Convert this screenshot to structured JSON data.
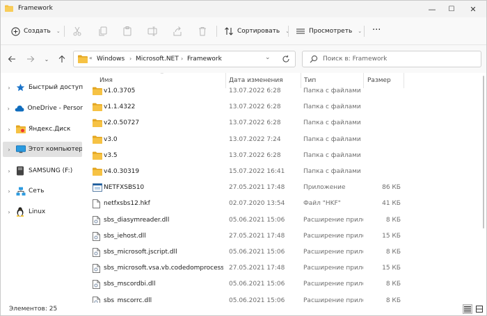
{
  "window": {
    "title": "Framework",
    "minimize": "—",
    "maximize": "☐",
    "close": "✕"
  },
  "toolbar": {
    "new_label": "Создать",
    "sort_label": "Сортировать",
    "view_label": "Просмотреть",
    "more": "···"
  },
  "address": {
    "overflow": "«",
    "crumbs": [
      "Windows",
      "Microsoft.NET",
      "Framework"
    ],
    "search_placeholder": "Поиск в: Framework"
  },
  "sidebar": {
    "items": [
      {
        "label": "Быстрый доступ",
        "icon": "star-icon"
      },
      {
        "label": "OneDrive - Personal",
        "icon": "cloud-icon"
      },
      {
        "label": "Яндекс.Диск",
        "icon": "folder-icon"
      },
      {
        "label": "Этот компьютер",
        "icon": "monitor-icon",
        "selected": true
      },
      {
        "label": "SAMSUNG (F:)",
        "icon": "drive-icon"
      },
      {
        "label": "Сеть",
        "icon": "network-icon"
      },
      {
        "label": "Linux",
        "icon": "linux-icon"
      }
    ]
  },
  "columns": {
    "name": "Имя",
    "date": "Дата изменения",
    "type": "Тип",
    "size": "Размер"
  },
  "files": [
    {
      "name": "v1.0.3705",
      "date": "13.07.2022 6:28",
      "type": "Папка с файлами",
      "size": "",
      "kind": "folder"
    },
    {
      "name": "v1.1.4322",
      "date": "13.07.2022 6:28",
      "type": "Папка с файлами",
      "size": "",
      "kind": "folder"
    },
    {
      "name": "v2.0.50727",
      "date": "13.07.2022 6:28",
      "type": "Папка с файлами",
      "size": "",
      "kind": "folder"
    },
    {
      "name": "v3.0",
      "date": "13.07.2022 7:24",
      "type": "Папка с файлами",
      "size": "",
      "kind": "folder"
    },
    {
      "name": "v3.5",
      "date": "13.07.2022 6:28",
      "type": "Папка с файлами",
      "size": "",
      "kind": "folder"
    },
    {
      "name": "v4.0.30319",
      "date": "15.07.2022 16:41",
      "type": "Папка с файлами",
      "size": "",
      "kind": "folder"
    },
    {
      "name": "NETFXSBS10",
      "date": "27.05.2021 17:48",
      "type": "Приложение",
      "size": "86 КБ",
      "kind": "app"
    },
    {
      "name": "netfxsbs12.hkf",
      "date": "02.07.2020 13:54",
      "type": "Файл \"HKF\"",
      "size": "41 КБ",
      "kind": "file"
    },
    {
      "name": "sbs_diasymreader.dll",
      "date": "05.06.2021 15:06",
      "type": "Расширение приложения",
      "size": "8 КБ",
      "kind": "dll"
    },
    {
      "name": "sbs_iehost.dll",
      "date": "27.05.2021 17:48",
      "type": "Расширение приложения",
      "size": "15 КБ",
      "kind": "dll"
    },
    {
      "name": "sbs_microsoft.jscript.dll",
      "date": "05.06.2021 15:06",
      "type": "Расширение приложения",
      "size": "8 КБ",
      "kind": "dll"
    },
    {
      "name": "sbs_microsoft.vsa.vb.codedomprocessor.dll",
      "date": "27.05.2021 17:48",
      "type": "Расширение приложения",
      "size": "15 КБ",
      "kind": "dll"
    },
    {
      "name": "sbs_mscordbi.dll",
      "date": "05.06.2021 15:06",
      "type": "Расширение приложения",
      "size": "8 КБ",
      "kind": "dll"
    },
    {
      "name": "sbs_mscorrc.dll",
      "date": "05.06.2021 15:06",
      "type": "Расширение приложения",
      "size": "8 КБ",
      "kind": "dll"
    }
  ],
  "status": {
    "items_count": "Элементов: 25"
  },
  "colors": {
    "folder": "#f6c244",
    "folder_dark": "#e3a520",
    "accent": "#0067c0",
    "selected_bg": "#e1e1e1"
  }
}
